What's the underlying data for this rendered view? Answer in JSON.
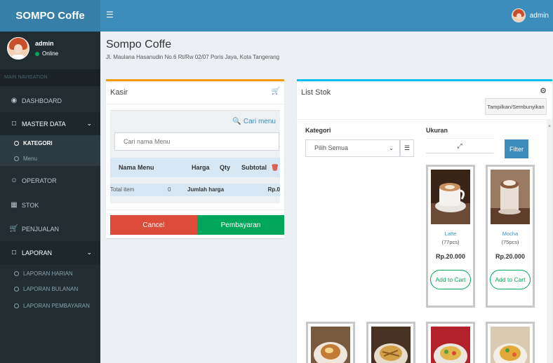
{
  "app": {
    "title": "SOMPO Coffe",
    "menu_icon": "hamburger-icon"
  },
  "topbar": {
    "user_name": "admin"
  },
  "sidebar": {
    "user": {
      "name": "admin",
      "status": "Online"
    },
    "nav_header": "MAIN NAVIGATION",
    "items": [
      {
        "label": "DASHBOARD",
        "icon": "dashboard-icon"
      },
      {
        "label": "MASTER DATA",
        "icon": "folder-icon"
      },
      {
        "label": "KATEGORI"
      },
      {
        "label": "Menu"
      },
      {
        "label": "OPERATOR",
        "icon": "user-icon"
      },
      {
        "label": "STOK",
        "icon": "cubes-icon"
      },
      {
        "label": "PENJUALAN",
        "icon": "cart-icon"
      },
      {
        "label": "LAPORAN",
        "icon": "folder-icon"
      },
      {
        "label": "LAPORAN HARIAN"
      },
      {
        "label": "LAPORAN BULANAN"
      },
      {
        "label": "LAPORAN PEMBAYARAN"
      }
    ]
  },
  "header": {
    "title": "Sompo Coffe",
    "address": "Jl. Maulana Hasanudin No.6 Rt/Rw 02/07 Poris Jaya, Kota Tangerang"
  },
  "kasir": {
    "title": "Kasir",
    "cari_menu": "Cari menu",
    "search_placeholder": "Cari nama Menu",
    "columns": {
      "nama": "Nama Menu",
      "harga": "Harga",
      "qty": "Qty",
      "subtotal": "Subtotal"
    },
    "footer": {
      "total_item_label": "Total item",
      "total_item_value": "0",
      "jumlah_label": "Jumlah harga",
      "jumlah_value": "Rp.0"
    },
    "cancel": "Cancel",
    "pay": "Pembayaran"
  },
  "stok": {
    "title": "List Stok",
    "toggle": "Tampilkan/Sembunyikan",
    "kategori_label": "Kategori",
    "kategori_value": "Pilih Semua",
    "ukuran_label": "Ukuran",
    "filter": "Filter",
    "products": [
      {
        "name": "Latte",
        "qty": "(77pcs)",
        "price": "Rp.20.000",
        "button": "Add to Cart"
      },
      {
        "name": "Mocha",
        "qty": "(75pcs)",
        "price": "Rp.20.000",
        "button": "Add to Cart"
      }
    ]
  },
  "colors": {
    "primary": "#3c8dbc",
    "sidebar": "#222d32",
    "danger": "#dd4b39",
    "success": "#00a65a",
    "warning": "#f39c12",
    "info": "#00c0ef"
  }
}
